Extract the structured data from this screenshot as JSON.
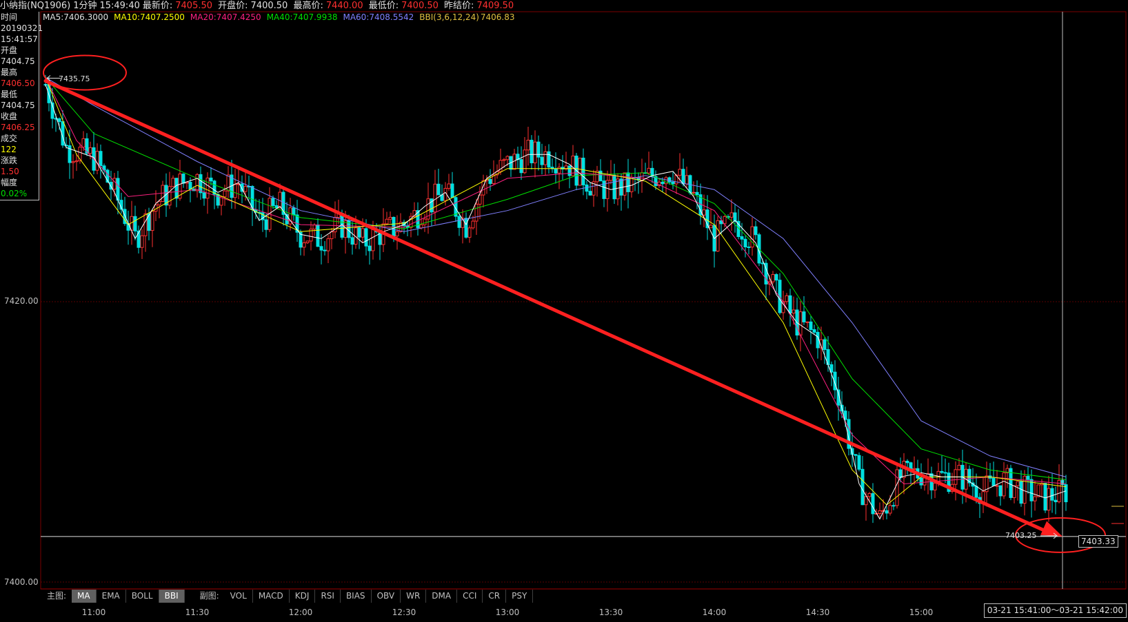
{
  "header": {
    "instrument": "小纳指(NQ1906)",
    "period": "1分钟",
    "time": "15:49:40",
    "last_label": "最新价:",
    "last_value": "7405.50",
    "open_label": "开盘价:",
    "open_value": "7400.50",
    "high_label": "最高价:",
    "high_value": "7440.00",
    "low_label": "最低价:",
    "low_value": "7400.50",
    "prev_label": "昨结价:",
    "prev_value": "7409.50"
  },
  "legend": {
    "ma5": "MA5:7406.3000",
    "ma10": "MA10:7407.2500",
    "ma20": "MA20:7407.4250",
    "ma40": "MA40:7407.9938",
    "ma60": "MA60:7408.5542",
    "bbi": "BBI(3,6,12,24)",
    "bbi_value": "7406.83"
  },
  "infobox": {
    "time_label": "时间",
    "date": "20190321",
    "time": "15:41:57",
    "open_label": "开盘",
    "open": "7404.75",
    "high_label": "最高",
    "high": "7406.50",
    "low_label": "最低",
    "low": "7404.75",
    "close_label": "收盘",
    "close": "7406.25",
    "volume_label": "成交",
    "volume": "122",
    "change_label": "涨跌",
    "change": "1.50",
    "pct_label": "幅度",
    "pct": "0.02%"
  },
  "yaxis": {
    "label_7420": "7420.00",
    "label_7400": "7400.00"
  },
  "annotations": {
    "high_mark": "7435.75",
    "low_mark": "7403.25",
    "cursor_price": "7403.33"
  },
  "buttons": {
    "main_label": "主图:",
    "main": [
      "MA",
      "EMA",
      "BOLL",
      "BBI"
    ],
    "sub_label": "副图:",
    "sub": [
      "VOL",
      "MACD",
      "KDJ",
      "RSI",
      "BIAS",
      "OBV",
      "WR",
      "DMA",
      "CCI",
      "CR",
      "PSY"
    ]
  },
  "timeaxis": {
    "ticks": [
      "11:00",
      "11:30",
      "12:00",
      "12:30",
      "13:00",
      "13:30",
      "14:00",
      "14:30",
      "15:00"
    ],
    "range": "03-21  15:41:00～03-21  15:42:00"
  },
  "colors": {
    "up": "#ff3030",
    "down": "#00e0e0",
    "ma5": "#ffffff",
    "ma10": "#ffff00",
    "ma20": "#ff2080",
    "ma40": "#00e000",
    "ma60": "#8080ff",
    "trend": "#ff2020"
  },
  "chart_data": {
    "type": "candlestick",
    "y_range": [
      7399,
      7440
    ],
    "x_ticks": [
      "11:00",
      "11:30",
      "12:00",
      "12:30",
      "13:00",
      "13:30",
      "14:00",
      "14:30",
      "15:00"
    ],
    "close_path": [
      [
        "10:46",
        7435.5
      ],
      [
        "10:52",
        7431.0
      ],
      [
        "11:00",
        7430.3
      ],
      [
        "11:06",
        7427.8
      ],
      [
        "11:12",
        7424.5
      ],
      [
        "11:18",
        7427.0
      ],
      [
        "11:24",
        7428.3
      ],
      [
        "11:30",
        7428.8
      ],
      [
        "11:36",
        7427.8
      ],
      [
        "11:42",
        7428.5
      ],
      [
        "11:48",
        7425.8
      ],
      [
        "11:54",
        7426.8
      ],
      [
        "12:00",
        7424.8
      ],
      [
        "12:06",
        7424.5
      ],
      [
        "12:12",
        7425.5
      ],
      [
        "12:18",
        7424.2
      ],
      [
        "12:24",
        7425.0
      ],
      [
        "12:30",
        7425.5
      ],
      [
        "12:36",
        7426.8
      ],
      [
        "12:42",
        7427.8
      ],
      [
        "12:48",
        7425.5
      ],
      [
        "12:54",
        7428.8
      ],
      [
        "13:00",
        7429.8
      ],
      [
        "13:06",
        7430.5
      ],
      [
        "13:12",
        7430.5
      ],
      [
        "13:18",
        7429.8
      ],
      [
        "13:24",
        7428.5
      ],
      [
        "13:30",
        7428.0
      ],
      [
        "13:36",
        7428.3
      ],
      [
        "13:42",
        7429.0
      ],
      [
        "13:48",
        7429.3
      ],
      [
        "13:54",
        7427.5
      ],
      [
        "14:00",
        7424.5
      ],
      [
        "14:06",
        7425.8
      ],
      [
        "14:12",
        7424.2
      ],
      [
        "14:18",
        7420.5
      ],
      [
        "14:24",
        7418.5
      ],
      [
        "14:30",
        7417.5
      ],
      [
        "14:36",
        7413.5
      ],
      [
        "14:42",
        7407.0
      ],
      [
        "14:48",
        7404.5
      ],
      [
        "14:54",
        7407.5
      ],
      [
        "15:00",
        7407.8
      ],
      [
        "15:06",
        7407.5
      ],
      [
        "15:12",
        7407.5
      ],
      [
        "15:18",
        7406.5
      ],
      [
        "15:24",
        7407.2
      ],
      [
        "15:30",
        7406.5
      ],
      [
        "15:36",
        7406.0
      ],
      [
        "15:42",
        7406.5
      ]
    ],
    "ma60_path": [
      [
        "10:46",
        7436.0
      ],
      [
        "11:00",
        7434.0
      ],
      [
        "11:30",
        7430.0
      ],
      [
        "12:00",
        7426.5
      ],
      [
        "12:30",
        7425.0
      ],
      [
        "13:00",
        7426.5
      ],
      [
        "13:20",
        7428.0
      ],
      [
        "13:40",
        7429.0
      ],
      [
        "14:00",
        7428.0
      ],
      [
        "14:20",
        7424.5
      ],
      [
        "14:40",
        7418.5
      ],
      [
        "15:00",
        7411.5
      ],
      [
        "15:20",
        7409.0
      ],
      [
        "15:42",
        7407.5
      ]
    ],
    "ma40_path": [
      [
        "10:46",
        7436.0
      ],
      [
        "11:00",
        7432.0
      ],
      [
        "11:30",
        7428.8
      ],
      [
        "12:00",
        7426.0
      ],
      [
        "12:30",
        7425.2
      ],
      [
        "13:00",
        7427.3
      ],
      [
        "13:20",
        7429.0
      ],
      [
        "13:40",
        7429.2
      ],
      [
        "14:00",
        7427.0
      ],
      [
        "14:20",
        7422.0
      ],
      [
        "14:40",
        7414.5
      ],
      [
        "15:00",
        7409.5
      ],
      [
        "15:20",
        7408.0
      ],
      [
        "15:42",
        7407.3
      ]
    ],
    "ma20_path": [
      [
        "10:46",
        7436.0
      ],
      [
        "10:55",
        7431.5
      ],
      [
        "11:10",
        7427.5
      ],
      [
        "11:30",
        7428.0
      ],
      [
        "12:00",
        7425.5
      ],
      [
        "12:30",
        7425.3
      ],
      [
        "13:00",
        7428.8
      ],
      [
        "13:20",
        7429.2
      ],
      [
        "13:40",
        7428.8
      ],
      [
        "14:00",
        7426.5
      ],
      [
        "14:20",
        7420.0
      ],
      [
        "14:40",
        7410.5
      ],
      [
        "14:55",
        7407.0
      ],
      [
        "15:20",
        7407.5
      ],
      [
        "15:42",
        7407.0
      ]
    ],
    "ma10_path": [
      [
        "10:46",
        7436.0
      ],
      [
        "10:55",
        7430.5
      ],
      [
        "11:10",
        7425.5
      ],
      [
        "11:30",
        7428.3
      ],
      [
        "12:00",
        7425.0
      ],
      [
        "12:30",
        7425.6
      ],
      [
        "13:00",
        7429.5
      ],
      [
        "13:20",
        7429.5
      ],
      [
        "13:40",
        7428.6
      ],
      [
        "14:00",
        7425.5
      ],
      [
        "14:20",
        7418.5
      ],
      [
        "14:40",
        7408.0
      ],
      [
        "14:50",
        7405.5
      ],
      [
        "15:00",
        7407.5
      ],
      [
        "15:20",
        7407.5
      ],
      [
        "15:42",
        7406.8
      ]
    ],
    "trend_line": {
      "from": [
        "10:46",
        7435.75
      ],
      "to": [
        "15:41",
        7403.25
      ]
    },
    "horizontal_line": 7403.25,
    "cursor_time": "15:41",
    "annotations": [
      {
        "text": "7435.75",
        "at": [
          "10:46",
          7435.75
        ]
      },
      {
        "text": "7403.25",
        "at": [
          "15:41",
          7403.25
        ]
      }
    ]
  }
}
